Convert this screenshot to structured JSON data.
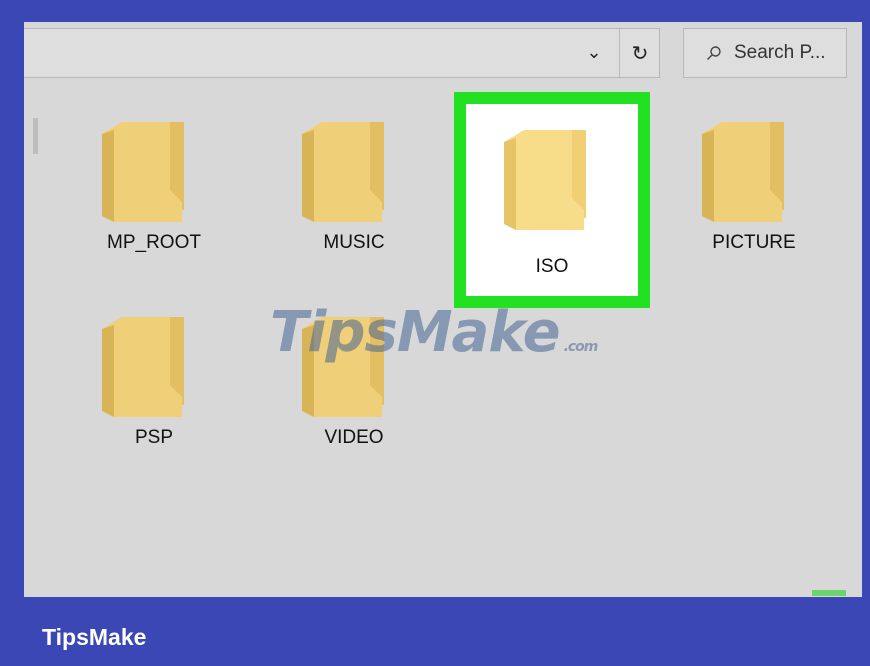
{
  "toolbar": {
    "dropdown_glyph": "⌄",
    "refresh_glyph": "↻",
    "search_placeholder": "Search P..."
  },
  "folders": [
    {
      "label": "MP_ROOT",
      "selected": false
    },
    {
      "label": "MUSIC",
      "selected": false
    },
    {
      "label": "ISO",
      "selected": true
    },
    {
      "label": "PICTURE",
      "selected": false
    },
    {
      "label": "PSP",
      "selected": false
    },
    {
      "label": "VIDEO",
      "selected": false
    }
  ],
  "watermark": {
    "center_text": "TipsMake",
    "center_domain": ".com",
    "footer_text": "TipsMake"
  },
  "colors": {
    "frame": "#3a47b5",
    "highlight": "#22e022",
    "folder": "#e8c66a"
  }
}
